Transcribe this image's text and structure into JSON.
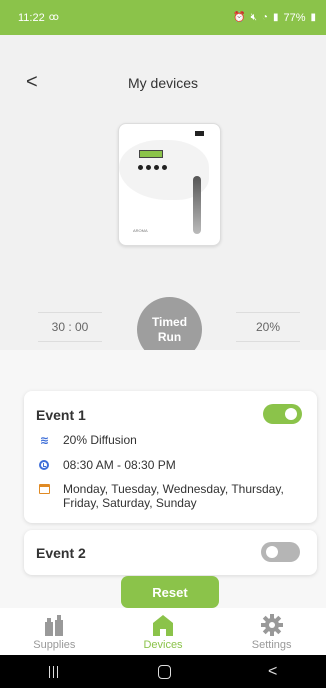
{
  "status_bar": {
    "time": "11:22",
    "left_icon": "voicemail-icon",
    "right_icons": [
      "alarm-icon",
      "mute-icon",
      "wifi-icon",
      "signal-icon"
    ],
    "battery": "77%"
  },
  "header": {
    "back_icon": "chevron-left-icon",
    "title": "My devices"
  },
  "device": {
    "image_description": "diffuser-device",
    "brand": "AROMA"
  },
  "timer": {
    "duration": "30 : 00",
    "button_line1": "Timed",
    "button_line2": "Run",
    "percent": "20%"
  },
  "events": [
    {
      "title": "Event 1",
      "enabled": true,
      "diffusion": "20% Diffusion",
      "time_range": "08:30 AM - 08:30 PM",
      "days_line1": "Monday, Tuesday, Wednesday, Thursday,",
      "days_line2": "Friday, Saturday, Sunday"
    },
    {
      "title": "Event 2",
      "enabled": false
    }
  ],
  "reset_label": "Reset",
  "tabs": [
    {
      "label": "Supplies",
      "icon": "bottles-icon",
      "active": false
    },
    {
      "label": "Devices",
      "icon": "home-icon",
      "active": true
    },
    {
      "label": "Settings",
      "icon": "gear-icon",
      "active": false
    }
  ],
  "colors": {
    "accent": "#8bc34a",
    "timed_run_bg": "#9e9e9e",
    "icon_blue": "#3f6fd8",
    "icon_orange": "#e08a24",
    "toggle_off": "#b5b5b5"
  },
  "system_nav": [
    "recents-icon",
    "home-button-icon",
    "back-icon"
  ]
}
